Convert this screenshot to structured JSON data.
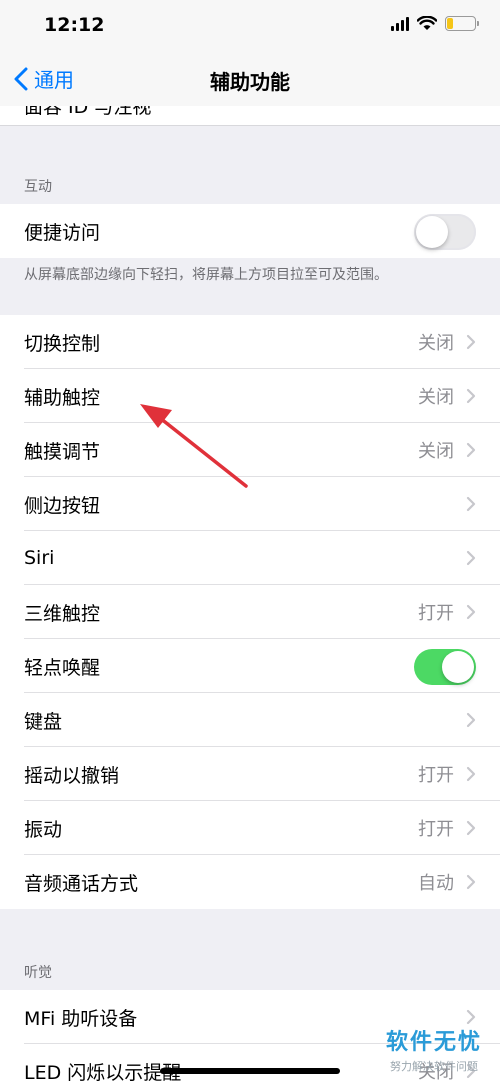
{
  "status_bar": {
    "time": "12:12",
    "battery_color": "#f5c518"
  },
  "nav": {
    "back_label": "通用",
    "title": "辅助功能"
  },
  "clipped_row": {
    "label": "面容 ID 与注视"
  },
  "sections": {
    "interaction": {
      "header": "互动",
      "reachability": {
        "label": "便捷访问",
        "toggle_on": false
      },
      "footer": "从屏幕底部边缘向下轻扫，将屏幕上方项目拉至可及范围。"
    },
    "rows": [
      {
        "label": "切换控制",
        "value": "关闭"
      },
      {
        "label": "辅助触控",
        "value": "关闭"
      },
      {
        "label": "触摸调节",
        "value": "关闭"
      },
      {
        "label": "侧边按钮",
        "value": ""
      },
      {
        "label": "Siri",
        "value": ""
      },
      {
        "label": "三维触控",
        "value": "打开"
      },
      {
        "label": "轻点唤醒",
        "toggle_on": true
      },
      {
        "label": "键盘",
        "value": ""
      },
      {
        "label": "摇动以撤销",
        "value": "打开"
      },
      {
        "label": "振动",
        "value": "打开"
      },
      {
        "label": "音频通话方式",
        "value": "自动"
      }
    ],
    "hearing": {
      "header": "听觉",
      "rows": [
        {
          "label": "MFi 助听设备",
          "value": ""
        },
        {
          "label": "LED 闪烁以示提醒",
          "value": "关闭"
        }
      ]
    }
  },
  "colors": {
    "accent": "#007aff",
    "toggle_on": "#4cd964",
    "arrow": "#e0313a"
  },
  "watermark": {
    "title": "软件无忧",
    "subtitle": "努力解决软件问题"
  }
}
